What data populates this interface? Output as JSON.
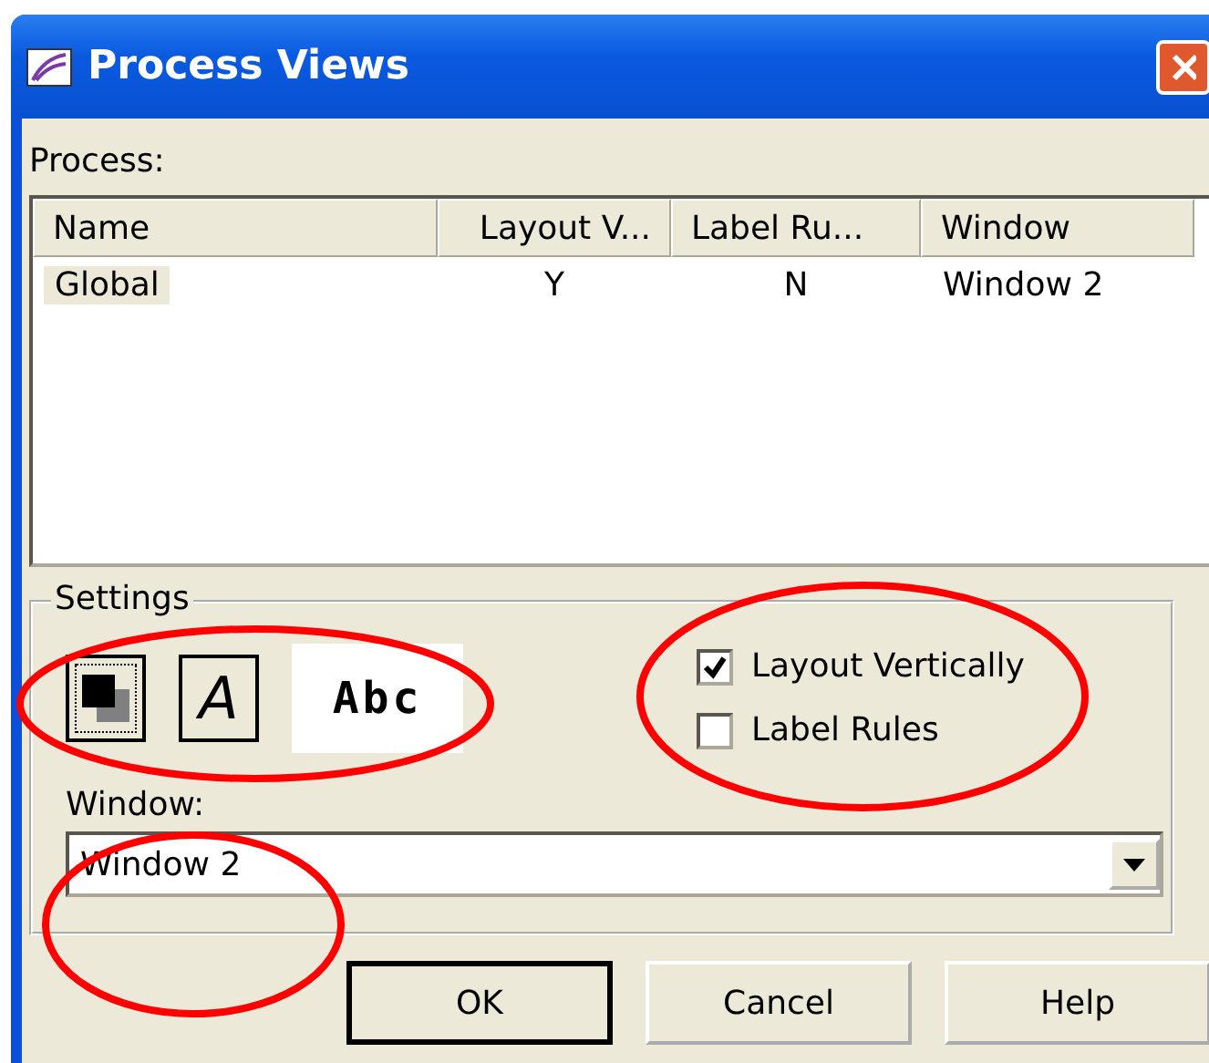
{
  "window": {
    "title": "Process Views"
  },
  "process_label": "Process:",
  "table": {
    "columns": [
      "Name",
      "Layout V...",
      "Label Ru...",
      "Window"
    ],
    "rows": [
      {
        "cells": [
          "Global",
          "Y",
          "N",
          "Window 2"
        ],
        "selected": true
      }
    ]
  },
  "settings": {
    "title": "Settings",
    "tools": [
      {
        "kind": "color",
        "selected": true
      },
      {
        "kind": "font",
        "glyph": "A",
        "selected": false
      }
    ],
    "preview": "Abc",
    "checkboxes": [
      {
        "label": "Layout Vertically",
        "checked": true
      },
      {
        "label": "Label Rules",
        "checked": false
      }
    ],
    "window_label": "Window:",
    "window_value": "Window 2"
  },
  "buttons": [
    {
      "label": "OK",
      "default": true
    },
    {
      "label": "Cancel",
      "default": false
    },
    {
      "label": "Help",
      "default": false
    }
  ],
  "annotations": [
    {
      "kind": "ellipse"
    },
    {
      "kind": "ellipse"
    },
    {
      "kind": "ellipse"
    }
  ]
}
